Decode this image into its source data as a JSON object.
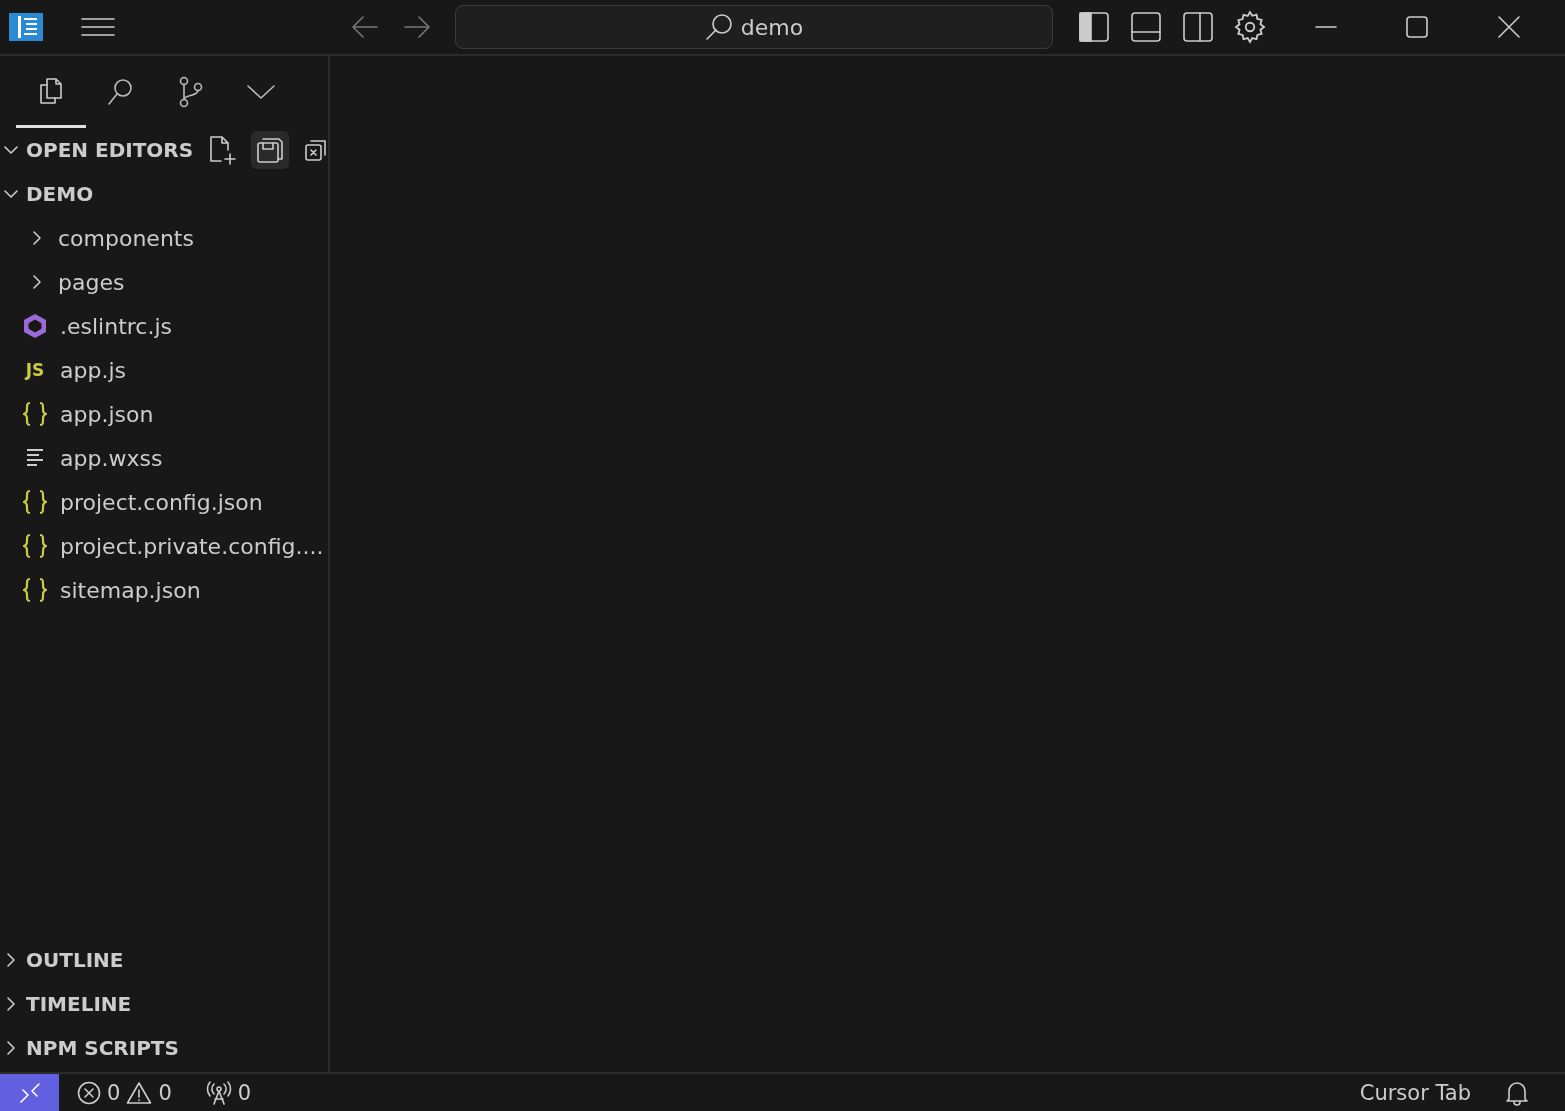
{
  "title_bar": {
    "search": "demo"
  },
  "activity_tabs": [
    {
      "kind": "explorer",
      "selected": true
    },
    {
      "kind": "search",
      "selected": false
    },
    {
      "kind": "source-control",
      "selected": false
    },
    {
      "kind": "more",
      "selected": false
    }
  ],
  "sections": [
    {
      "kind": "open_editors",
      "title": "OPEN EDITORS",
      "expanded": true
    },
    {
      "kind": "folder",
      "title": "DEMO",
      "expanded": true,
      "children": [
        {
          "kind": "folder",
          "name": "components",
          "expanded": false
        },
        {
          "kind": "folder",
          "name": "pages",
          "expanded": false
        },
        {
          "kind": "eslint",
          "name": ".eslintrc.js"
        },
        {
          "kind": "js",
          "icon_text": "JS",
          "name": "app.js"
        },
        {
          "kind": "json",
          "name": "app.json"
        },
        {
          "kind": "text",
          "name": "app.wxss"
        },
        {
          "kind": "json",
          "name": "project.config.json"
        },
        {
          "kind": "json",
          "name": "project.private.config...."
        },
        {
          "kind": "json",
          "name": "sitemap.json"
        }
      ]
    }
  ],
  "bottom_sections": [
    {
      "title": "OUTLINE",
      "expanded": false
    },
    {
      "title": "TIMELINE",
      "expanded": false
    },
    {
      "title": "NPM SCRIPTS",
      "expanded": false
    }
  ],
  "status_bar": {
    "errors": "0",
    "warnings": "0",
    "ports": "0",
    "right_text": "Cursor Tab"
  }
}
